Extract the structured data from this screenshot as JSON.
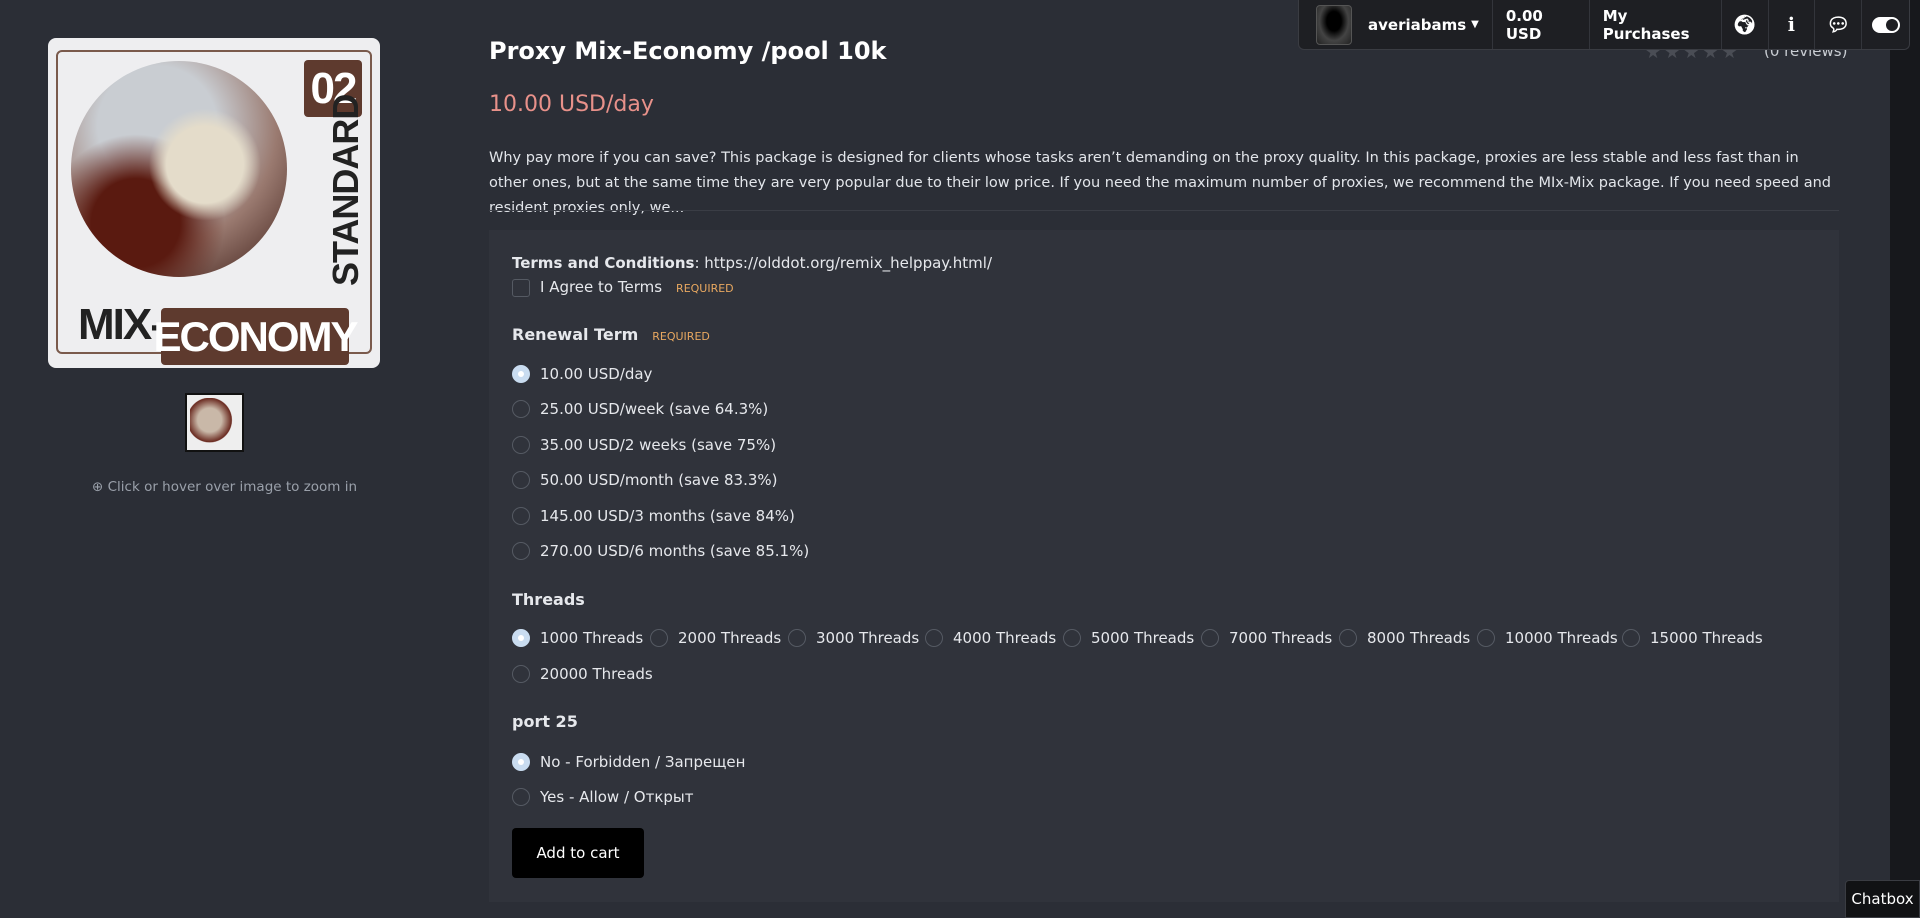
{
  "header": {
    "username": "averiabams",
    "balance": "0.00 USD",
    "purchases": "My Purchases"
  },
  "gallery": {
    "logo_text": [
      "02",
      "STANDARD",
      "MIX-",
      "ECONOMY"
    ],
    "zoom_hint": "Click or hover over image to zoom in"
  },
  "product": {
    "title": "Proxy Mix-Economy /pool 10k",
    "rating": 0,
    "reviews": "(0 reviews)",
    "price": "10.00 USD/day",
    "description": "Why pay more if you can save? This package is designed for clients whose tasks aren’t demanding on the proxy quality. In this package, proxies are less stable and less fast than in other ones, but at the same time they are very popular due to their low price. If you need the maximum number of proxies, we recommend the MIx-Mix package. If you need speed and resident proxies only, we..."
  },
  "form": {
    "terms_label": "Terms and Conditions",
    "terms_url": "https://olddot.org/remix_helppay.html/",
    "agree": "I Agree to Terms",
    "required": "REQUIRED",
    "renewal_label": "Renewal Term",
    "renewal": [
      "10.00 USD/day",
      "25.00 USD/week (save 64.3%)",
      "35.00 USD/2 weeks (save 75%)",
      "50.00 USD/month (save 83.3%)",
      "145.00 USD/3 months (save 84%)",
      "270.00 USD/6 months (save 85.1%)"
    ],
    "threads_label": "Threads",
    "threads": [
      "1000 Threads",
      "2000 Threads",
      "3000 Threads",
      "4000 Threads",
      "5000 Threads",
      "7000 Threads",
      "8000 Threads",
      "10000 Threads",
      "15000 Threads",
      "20000 Threads"
    ],
    "port_label": "port 25",
    "port": [
      "No - Forbidden / Запрещен",
      "Yes - Allow / Открыт"
    ],
    "add_to_cart": "Add to cart"
  },
  "chatbox": "Chatbox",
  "colors": {
    "price": "#e8918a",
    "required": "#e8a860",
    "bg": "#2b2e36"
  }
}
